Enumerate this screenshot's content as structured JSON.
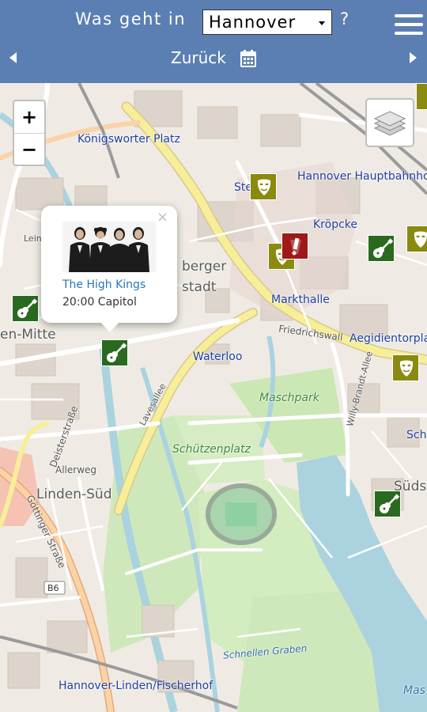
{
  "header": {
    "title": "Was geht in",
    "city": "Hannover",
    "question": "?",
    "back_label": "Zurück"
  },
  "map": {
    "labels": {
      "koenigsworter": "Königsworter Platz",
      "hauptbahnhof": "Hannover Hauptbahnhof",
      "kroepcke": "Kröpcke",
      "markthalle": "Markthalle",
      "friedrichswall": "Friedrichswall",
      "aegidientorplatz": "Aegidientorpla",
      "waterloo": "Waterloo",
      "maschpark": "Maschpark",
      "schuetzenplatz": "Schützenplatz",
      "linden_sud": "Linden-Süd",
      "linden_mitte": "en-Mitte",
      "berger": "berger",
      "stadt": "stadt",
      "ste": "Ste",
      "leine_top": "Leine",
      "deisterstrasse": "Deisterstraße",
      "allerweg": "Allerweg",
      "goettinger": "Göttinger Straße",
      "lavesallee": "Lavesallee",
      "willy_brandt": "Willy-Brandt-Allee",
      "b6": "B6",
      "fischerhof": "Hannover-Linden/Fischerhof",
      "schnellen": "Schnellen Graben",
      "sudst": "Südst",
      "sch": "Sch",
      "mas": "Mas",
      "lein": "Lein"
    },
    "zoom_in": "+",
    "zoom_out": "−"
  },
  "popup": {
    "close": "×",
    "title": "The High Kings",
    "detail": "20:00 Capitol"
  },
  "colors": {
    "header": "#5b7fb3",
    "music_marker": "#2a6a1f",
    "theater_marker": "#8a8a10",
    "alert_marker": "#a01818",
    "link": "#2876b8"
  }
}
